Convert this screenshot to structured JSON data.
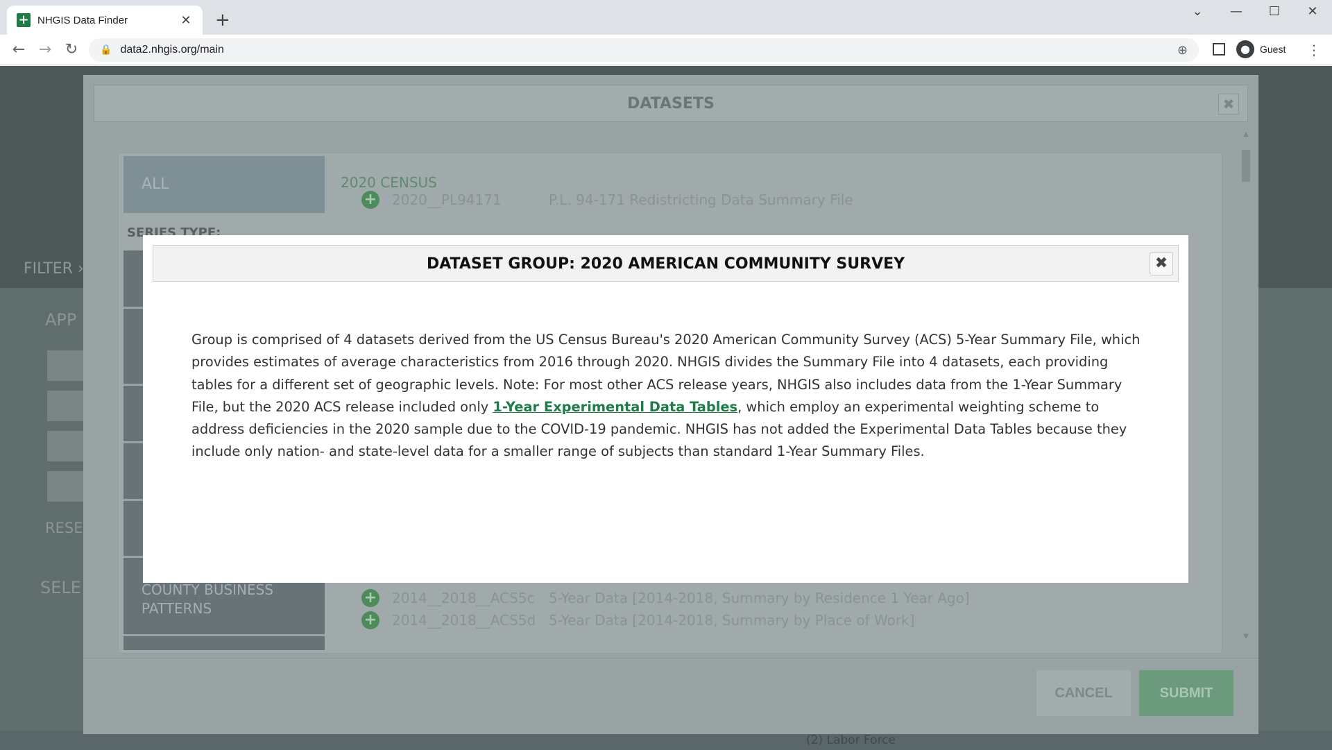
{
  "browser": {
    "tab_title": "NHGIS Data Finder",
    "tab_close": "✕",
    "new_tab": "+",
    "url": "data2.nhgis.org/main",
    "profile_name": "Guest"
  },
  "page": {
    "filter_text": "FILTER ›",
    "app_text": "APP",
    "reset_text": "RESE",
    "select_text": "SELE",
    "bottom_label": "(2) Labor Force"
  },
  "datasets_modal": {
    "title": "DATASETS",
    "all_tab": "ALL",
    "series_type_label": "SERIES TYPE:",
    "series_county": "COUNTY BUSINESS PATTERNS",
    "census_group": "2020 CENSUS",
    "rows_top": [
      {
        "code": "2020__PL94171",
        "desc": "P.L. 94-171 Redistricting Data Summary File"
      }
    ],
    "rows_bottom": [
      {
        "code": "2014__2018__ACS5c",
        "desc": "5-Year Data [2014-2018, Summary by Residence 1 Year Ago]"
      },
      {
        "code": "2014__2018__ACS5d",
        "desc": "5-Year Data [2014-2018, Summary by Place of Work]"
      }
    ],
    "cancel_label": "CANCEL",
    "submit_label": "SUBMIT"
  },
  "dialog": {
    "title": "DATASET GROUP: 2020 AMERICAN COMMUNITY SURVEY",
    "text_before": "Group is comprised of 4 datasets derived from the US Census Bureau's 2020 American Community Survey (ACS) 5-Year Summary File, which provides estimates of average characteristics from 2016 through 2020. NHGIS divides the Summary File into 4 datasets, each providing tables for a different set of geographic levels. Note: For most other ACS release years, NHGIS also includes data from the 1-Year Summary File, but the 2020 ACS release included only ",
    "link_text": "1-Year Experimental Data Tables",
    "text_after": ", which employ an experimental weighting scheme to address deficiencies in the 2020 sample due to the COVID-19 pandemic. NHGIS has not added the Experimental Data Tables because they include only nation- and state-level data for a smaller range of subjects than standard 1-Year Summary Files."
  }
}
